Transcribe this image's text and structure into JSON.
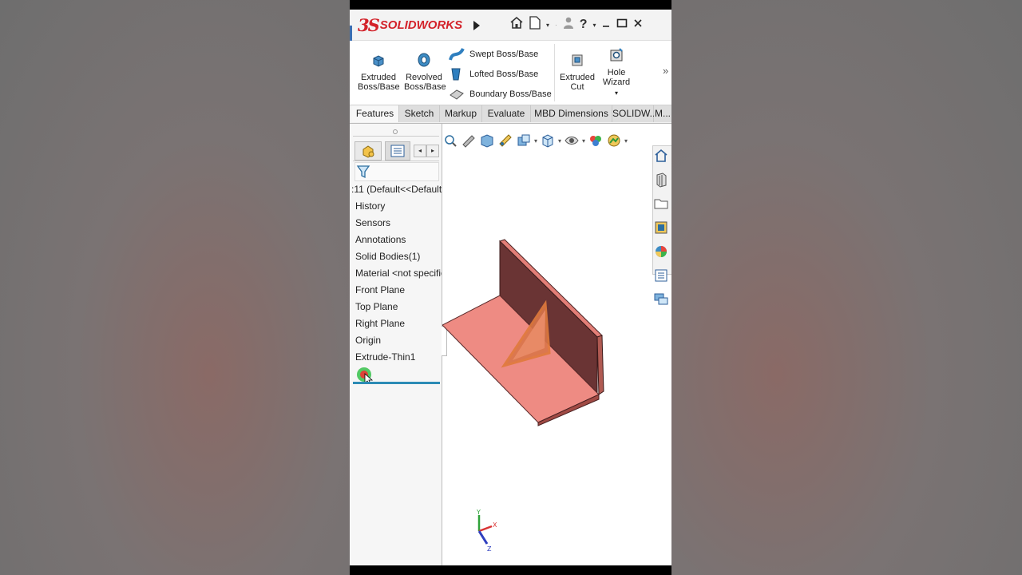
{
  "app": {
    "brand_prefix": "3S",
    "brand": "SOLIDWORKS"
  },
  "titlebar": {
    "icons": [
      "home-icon",
      "new-document-icon",
      "dropdown-icon",
      "user-icon",
      "help-icon",
      "dropdown-icon",
      "minimize-icon",
      "maximize-icon",
      "close-icon"
    ],
    "help_label": "?"
  },
  "ribbon": {
    "extruded_boss": "Extruded Boss/Base",
    "revolved_boss": "Revolved Boss/Base",
    "swept_boss": "Swept Boss/Base",
    "lofted_boss": "Lofted Boss/Base",
    "boundary_boss": "Boundary Boss/Base",
    "extruded_cut": "Extruded Cut",
    "hole_wizard": "Hole Wizard",
    "more": "»"
  },
  "tabs": [
    {
      "label": "Features",
      "active": true
    },
    {
      "label": "Sketch"
    },
    {
      "label": "Markup"
    },
    {
      "label": "Evaluate"
    },
    {
      "label": "MBD Dimensions"
    },
    {
      "label": "SOLIDW..."
    },
    {
      "label": "M..."
    }
  ],
  "tree": {
    "root": ":11  (Default<<Default",
    "items": [
      "History",
      "Sensors",
      "Annotations",
      "Solid Bodies(1)",
      "Material <not specifie",
      "Front Plane",
      "Top Plane",
      "Right Plane",
      "Origin",
      "Extrude-Thin1"
    ]
  },
  "colors": {
    "part_face": "#ee8b83",
    "part_wall": "#6a3434",
    "rib": "#e07a3c",
    "rollback": "#2c8bb5",
    "brand": "#d3222a"
  }
}
